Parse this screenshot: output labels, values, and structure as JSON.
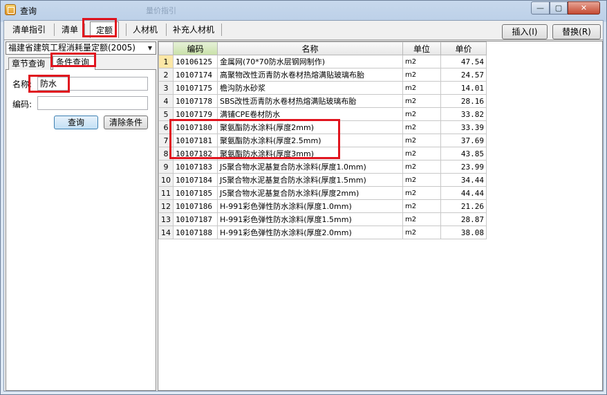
{
  "window": {
    "title": "查询",
    "ghost_title": "量价指引",
    "min_glyph": "—",
    "max_glyph": "▢",
    "close_glyph": "✕"
  },
  "tabs": [
    {
      "label": "清单指引"
    },
    {
      "label": "清单"
    },
    {
      "label": "定额"
    },
    {
      "label": "人材机"
    },
    {
      "label": "补充人材机"
    }
  ],
  "actions": {
    "insert_label": "插入(I)",
    "replace_label": "替换(R)"
  },
  "left": {
    "quota_select": "福建省建筑工程消耗量定额(2005)",
    "subtabs": [
      "章节查询",
      "条件查询"
    ],
    "name_label": "名称:",
    "name_value": "防水",
    "code_label": "编码:",
    "code_value": "",
    "query_button": "查询",
    "clear_button": "清除条件"
  },
  "grid": {
    "columns": [
      "编码",
      "名称",
      "单位",
      "单价"
    ],
    "rows": [
      {
        "idx": "1",
        "code": "10106125",
        "name": "金属网(70*70防水层钢网制作)",
        "unit": "m2",
        "price": "47.54"
      },
      {
        "idx": "2",
        "code": "10107174",
        "name": "高聚物改性沥青防水卷材热熔满贴玻璃布胎",
        "unit": "m2",
        "price": "24.57"
      },
      {
        "idx": "3",
        "code": "10107175",
        "name": "檐沟防水砂浆",
        "unit": "m2",
        "price": "14.01"
      },
      {
        "idx": "4",
        "code": "10107178",
        "name": "SBS改性沥青防水卷材热熔满贴玻璃布胎",
        "unit": "m2",
        "price": "28.16"
      },
      {
        "idx": "5",
        "code": "10107179",
        "name": "满铺CPE卷材防水",
        "unit": "m2",
        "price": "33.82"
      },
      {
        "idx": "6",
        "code": "10107180",
        "name": "聚氨酯防水涂料(厚度2mm)",
        "unit": "m2",
        "price": "33.39"
      },
      {
        "idx": "7",
        "code": "10107181",
        "name": "聚氨酯防水涂料(厚度2.5mm)",
        "unit": "m2",
        "price": "37.69"
      },
      {
        "idx": "8",
        "code": "10107182",
        "name": "聚氨酯防水涂料(厚度3mm)",
        "unit": "m2",
        "price": "43.85"
      },
      {
        "idx": "9",
        "code": "10107183",
        "name": "JS聚合物水泥基复合防水涂料(厚度1.0mm)",
        "unit": "m2",
        "price": "23.99"
      },
      {
        "idx": "10",
        "code": "10107184",
        "name": "JS聚合物水泥基复合防水涂料(厚度1.5mm)",
        "unit": "m2",
        "price": "34.44"
      },
      {
        "idx": "11",
        "code": "10107185",
        "name": "JS聚合物水泥基复合防水涂料(厚度2mm)",
        "unit": "m2",
        "price": "44.44"
      },
      {
        "idx": "12",
        "code": "10107186",
        "name": "H-991彩色弹性防水涂料(厚度1.0mm)",
        "unit": "m2",
        "price": "21.26"
      },
      {
        "idx": "13",
        "code": "10107187",
        "name": "H-991彩色弹性防水涂料(厚度1.5mm)",
        "unit": "m2",
        "price": "28.87"
      },
      {
        "idx": "14",
        "code": "10107188",
        "name": "H-991彩色弹性防水涂料(厚度2.0mm)",
        "unit": "m2",
        "price": "38.08"
      }
    ]
  },
  "colors": {
    "highlight": "#e0141e",
    "selected_index": "#fbe7a6",
    "code_header": "#c8e0a8"
  }
}
